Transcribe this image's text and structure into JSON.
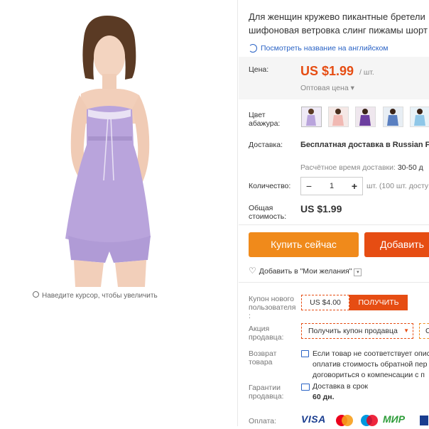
{
  "product": {
    "title_line1": "Для женщин кружево пикантные бретели",
    "title_line2": "шифоновая ветровка слинг пижамы шорт",
    "translate_link": "Посмотреть название на английском",
    "zoom_hint": "Наведите курсор, чтобы увеличить"
  },
  "price": {
    "label": "Цена:",
    "value": "US $1.99",
    "unit": "/ шт.",
    "wholesale": "Оптовая цена ▾"
  },
  "color": {
    "label_line1": "Цвет",
    "label_line2": "абажура:",
    "swatches": [
      "purple",
      "pink",
      "violet",
      "blue",
      "light-blue"
    ]
  },
  "shipping": {
    "label": "Доставка:",
    "method": "Бесплатная доставка в Russian Fec",
    "time_label": "Расчётное время доставки:",
    "time_value": "30-50 д"
  },
  "quantity": {
    "label": "Количество:",
    "value": "1",
    "minus": "−",
    "plus": "+",
    "note": "шт. (100 шт. досту"
  },
  "total": {
    "label_line1": "Общая",
    "label_line2": "стоимость:",
    "value": "US $1.99"
  },
  "actions": {
    "buy_now": "Купить сейчас",
    "add_to_cart": "Добавить"
  },
  "wishlist": {
    "label": "Добавить в \"Мои желания\""
  },
  "coupon": {
    "new_user_label_1": "Купон нового",
    "new_user_label_2": "пользователя",
    "new_user_label_3": ":",
    "amount": "US $4.00",
    "get_button": "ПОЛУЧИТЬ",
    "seller_label_1": "Акция",
    "seller_label_2": "продавца:",
    "seller_button": "Получить купон продавца",
    "seller_extra": "С"
  },
  "returns": {
    "label_1": "Возврат",
    "label_2": "товара",
    "line1": "Если товар не соответствует опис",
    "line2": "оплатив стоимость обратной пер",
    "line3": "договориться о компенсации с п"
  },
  "guarantee": {
    "label_1": "Гарантии",
    "label_2": "продавца:",
    "line1": "Доставка в срок",
    "line2": "60 дн."
  },
  "payment": {
    "label": "Оплата:",
    "visa": "VISA",
    "mir": "МИР"
  },
  "colors": {
    "accent_orange": "#f08a1b",
    "accent_red": "#e64d13",
    "link_blue": "#2a63c5",
    "garment_lavender": "#b9a4dc"
  }
}
